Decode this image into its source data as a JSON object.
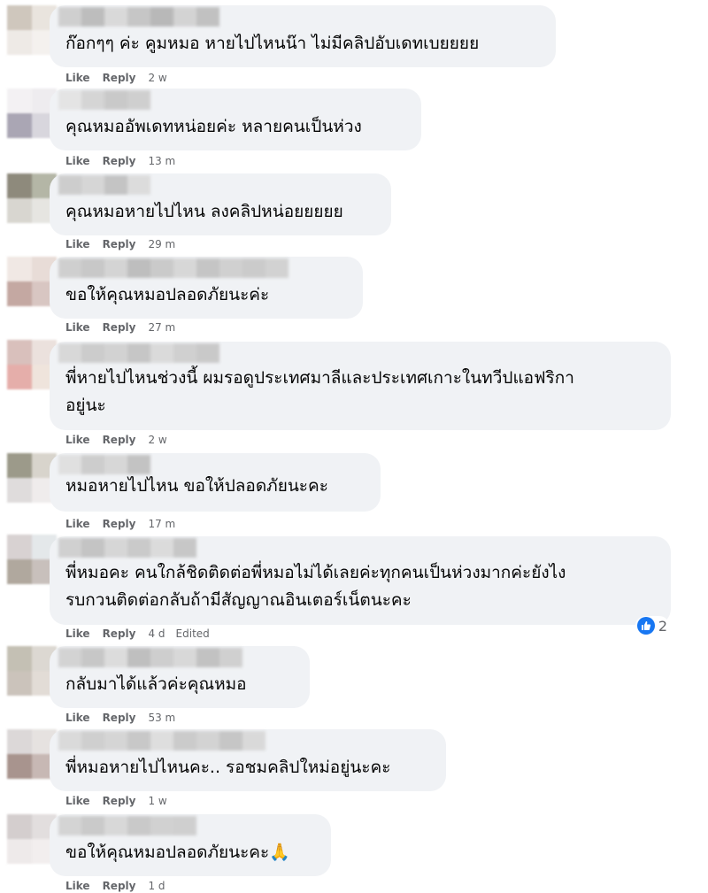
{
  "labels": {
    "like": "Like",
    "reply": "Reply",
    "edited": "Edited"
  },
  "comments": [
    {
      "text": "ก๊อกๆๆ ค่ะ คูมหมอ หายไปไหนน๊า ไม่มีคลิปอับเดทเบยยยย",
      "time": "2 w",
      "avatar": [
        "#cfc7bd",
        "#e9e4de",
        "#eeeae6",
        "#f4f1ee"
      ],
      "name": [
        "#cfcfcf",
        "#bdbdbd",
        "#d9d9d9",
        "#c6c6c6",
        "#b8b8b8",
        "#d3d3d3",
        "#c1c1c1"
      ]
    },
    {
      "text": "คุณหมออัพเดทหน่อยค่ะ หลายคนเป็นห่วง",
      "time": "13 m",
      "avatar": [
        "#f3f1f3",
        "#eeecef",
        "#aaa6b4",
        "#d8d6dd"
      ],
      "name": [
        "#e4e4e4",
        "#d5d5d5",
        "#c9c9c9",
        "#cfcfcf"
      ]
    },
    {
      "text": "คุณหมอหายไปไหน ลงคลิปหน่อยยยยย",
      "time": "29 m",
      "avatar": [
        "#8e8a7c",
        "#b4b6a6",
        "#d8d6d0",
        "#e6e5e1"
      ],
      "name": [
        "#cdcdcd",
        "#d6d6d6",
        "#c4c4c4",
        "#dcdcdc"
      ]
    },
    {
      "text": "ขอให้คุณหมอปลอดภัยนะค่ะ",
      "time": "27 m",
      "avatar": [
        "#f0e8e4",
        "#e8dcd7",
        "#c4a8a2",
        "#d8c6c2"
      ],
      "name": [
        "#cfcfcf",
        "#c8c8c8",
        "#d4d4d4",
        "#bebebe",
        "#cacaca",
        "#d7d7d7",
        "#c5c5c5",
        "#d0d0d0",
        "#cbcbcb",
        "#d2d2d2"
      ]
    },
    {
      "text": "พี่หายไปไหนช่วงนี้ ผมรอดูประเทศมาลีและประเทศเกาะในทวีปแอฟริกา\nอยู่นะ",
      "time": "2 w",
      "avatar": [
        "#d9c0bc",
        "#ebe1dd",
        "#e5aeaa",
        "#efe4dc"
      ],
      "name": [
        "#d8d8d8",
        "#cccccc",
        "#d2d2d2",
        "#c6c6c6",
        "#dadada",
        "#d0d0d0",
        "#c9c9c9"
      ]
    },
    {
      "text": "หมอหายไปไหน ขอให้ปลอดภัยนะคะ",
      "time": "17 m",
      "avatar": [
        "#9c9a8a",
        "#d8d4cc",
        "#dfdcdc",
        "#efecec"
      ],
      "name": [
        "#e0e0e0",
        "#cdcdcd",
        "#d7d7d7",
        "#c3c3c3"
      ]
    },
    {
      "text": "พี่หมอคะ คนใกล้ชิดติดต่อพี่หมอไม่ได้เลยค่ะทุกคนเป็นห่วงมากค่ะยังไง\nรบกวนติดต่อกลับถ้ามีสัญญาณอินเตอร์เน็ตนะคะ",
      "time": "4 d",
      "edited": true,
      "reactions": "2",
      "avatar": [
        "#d8d2d2",
        "#e4e8ea",
        "#b0a89e",
        "#c8c0bc"
      ],
      "name": [
        "#d0d0d0",
        "#c4c4c4",
        "#d6d6d6",
        "#cacaca",
        "#dbdbdb",
        "#c7c7c7"
      ]
    },
    {
      "text": "กลับมาได้แล้วค่ะคุณหมอ",
      "time": "53 m",
      "avatar": [
        "#c4c0b4",
        "#dcd8d2",
        "#cbc3bb",
        "#e2dcd6"
      ],
      "name": [
        "#d3d3d3",
        "#c7c7c7",
        "#dcdcdc",
        "#bfbfbf",
        "#cecece",
        "#d8d8d8",
        "#c2c2c2",
        "#d0d0d0"
      ]
    },
    {
      "text": "พี่หมอหายไปไหนคะ.. รอชมคลิปใหม่อยู่นะคะ",
      "time": "1 w",
      "avatar": [
        "#dcd8d8",
        "#e6e2e0",
        "#a8948e",
        "#c7b8b4"
      ],
      "name": [
        "#dadada",
        "#cfcfcf",
        "#d5d5d5",
        "#c8c8c8",
        "#dedede",
        "#cbcbcb",
        "#d3d3d3",
        "#c6c6c6",
        "#d9d9d9"
      ]
    },
    {
      "text": "ขอให้คุณหมอปลอดภัยนะคะ🙏",
      "time": "1 d",
      "avatar": [
        "#d4cece",
        "#e2dede",
        "#eeeaea",
        "#f2eeee"
      ],
      "name": [
        "#d4d4d4",
        "#cacaca",
        "#d8d8d8",
        "#c9c9c9",
        "#d1d1d1",
        "#cfcfcf"
      ]
    }
  ]
}
